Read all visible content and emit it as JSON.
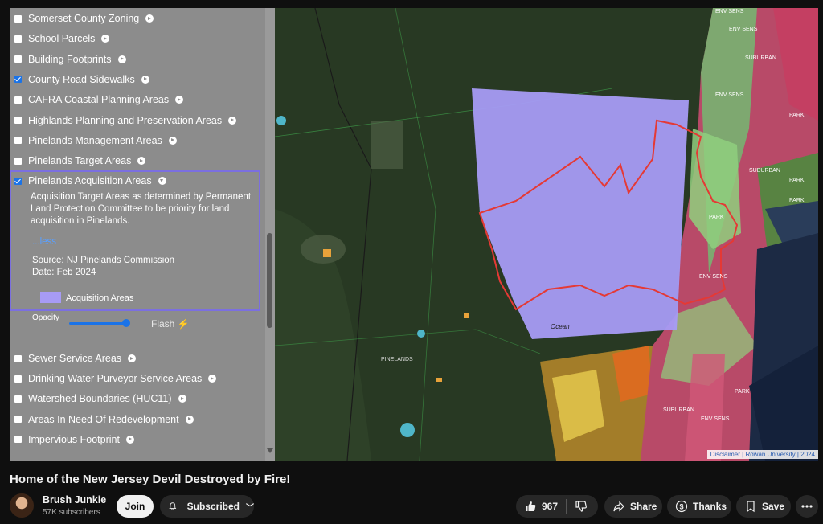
{
  "layers_top": [
    {
      "label": "Somerset County Zoning",
      "checked": false
    },
    {
      "label": "School Parcels",
      "checked": false
    },
    {
      "label": "Building Footprints",
      "checked": false
    },
    {
      "label": "County Road Sidewalks",
      "checked": true
    },
    {
      "label": "CAFRA Coastal Planning Areas",
      "checked": false
    },
    {
      "label": "Highlands Planning and Preservation Areas",
      "checked": false
    },
    {
      "label": "Pinelands Management Areas",
      "checked": false
    },
    {
      "label": "Pinelands Target Areas",
      "checked": false
    }
  ],
  "expanded_layer": {
    "label": "Pinelands Acquisition Areas",
    "checked": true,
    "description": "Acquisition Target Areas as determined by Permanent Land Protection Committee to be priority for land acquisition in Pinelands.",
    "less_link": "...less",
    "source": "Source: NJ Pinelands Commission",
    "date": "Date: Feb 2024",
    "legend_label": "Acquisition Areas",
    "legend_color": "#a79bf5",
    "opacity_label": "Opacity",
    "opacity_value": 0.9,
    "flash_label": "Flash"
  },
  "layers_bottom": [
    {
      "label": "Sewer Service Areas",
      "checked": false
    },
    {
      "label": "Drinking Water Purveyor Service Areas",
      "checked": false
    },
    {
      "label": "Watershed Boundaries (HUC11)",
      "checked": false
    },
    {
      "label": "Areas In Need Of Redevelopment",
      "checked": false
    },
    {
      "label": "Impervious Footprint",
      "checked": false
    }
  ],
  "map_labels": {
    "env_sens": "ENV SENS",
    "suburban": "SUBURBAN",
    "park": "PARK",
    "ocean": "Ocean",
    "pinelands": "PINELANDS"
  },
  "attribution": "Disclaimer | Rowan University | 2024",
  "video": {
    "title": "Home of the New Jersey Devil Destroyed by Fire!",
    "channel": "Brush Junkie",
    "subscribers": "57K subscribers",
    "join_label": "Join",
    "subscribe_label": "Subscribed",
    "likes": "967",
    "share_label": "Share",
    "thanks_label": "Thanks",
    "save_label": "Save"
  },
  "colors": {
    "accent": "#1a73e8",
    "panel_bg": "#8c8c8c",
    "expanded_border": "#7b6fe0",
    "polygon_fill": "#a79bf5",
    "outline_red": "#e53935"
  }
}
